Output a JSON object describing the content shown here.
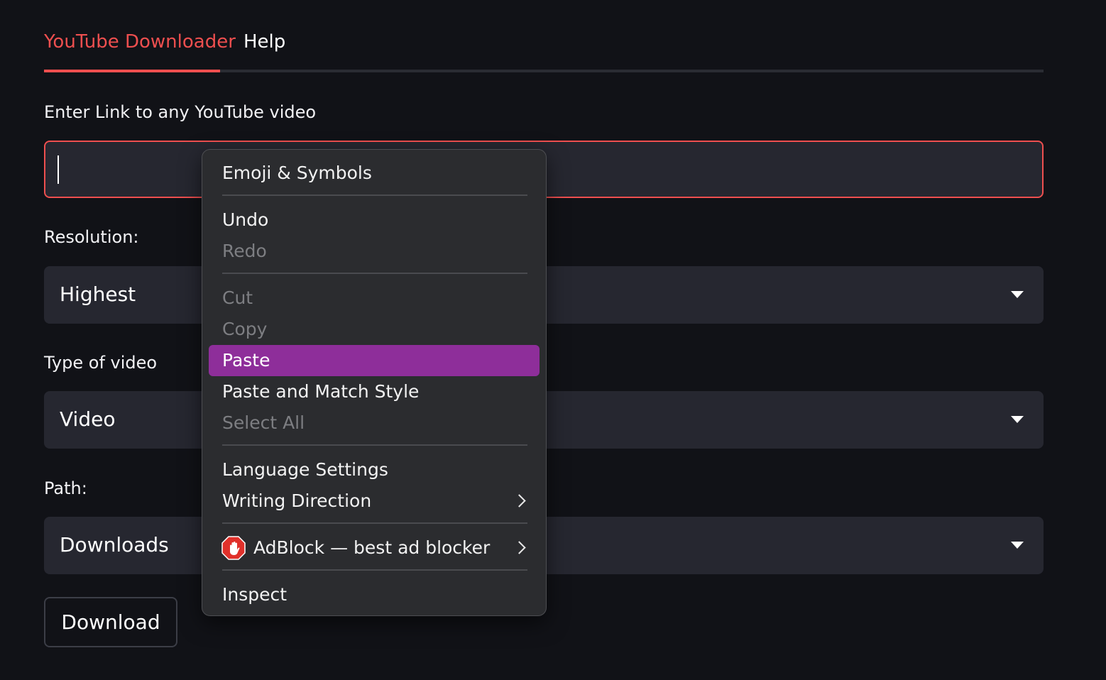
{
  "tabs": [
    {
      "label": "YouTube Downloader",
      "active": true
    },
    {
      "label": "Help",
      "active": false
    }
  ],
  "link_input": {
    "label": "Enter Link to any YouTube video",
    "value": ""
  },
  "resolution": {
    "label": "Resolution:",
    "selected": "Highest"
  },
  "video_type": {
    "label": "Type of video",
    "selected": "Video"
  },
  "path": {
    "label": "Path:",
    "selected": "Downloads"
  },
  "download_button": {
    "label": "Download"
  },
  "context_menu": {
    "emoji": "Emoji & Symbols",
    "undo": "Undo",
    "redo": "Redo",
    "cut": "Cut",
    "copy": "Copy",
    "paste": "Paste",
    "paste_match": "Paste and Match Style",
    "select_all": "Select All",
    "language": "Language Settings",
    "writing_direction": "Writing Direction",
    "adblock": "AdBlock — best ad blocker",
    "inspect": "Inspect"
  },
  "colors": {
    "accent": "#ee4f4f",
    "background": "#111217",
    "field": "#262730",
    "menu_highlight": "#8e2e9a"
  }
}
